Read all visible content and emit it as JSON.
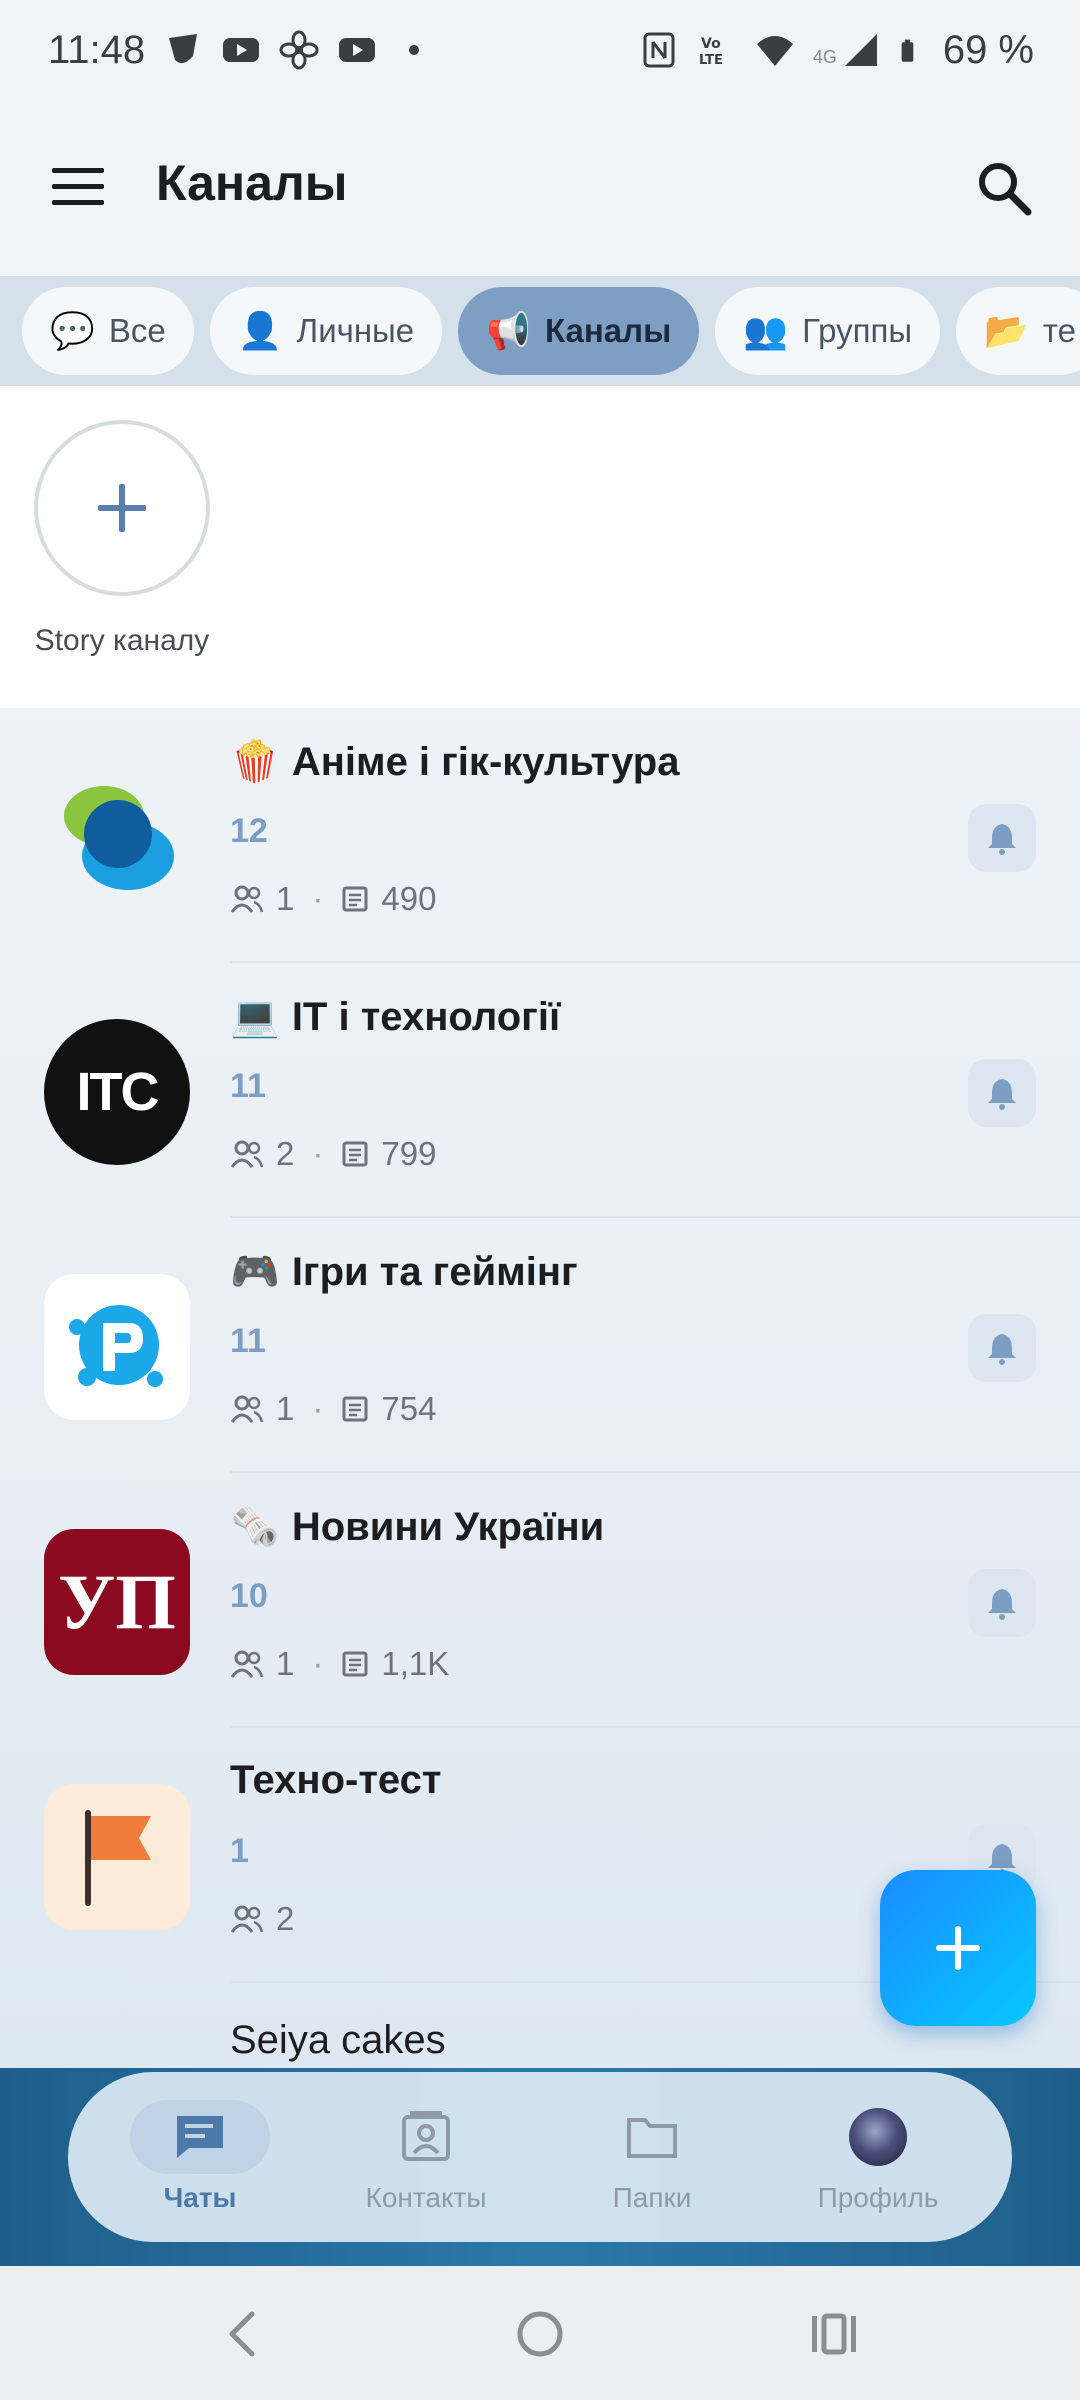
{
  "status_bar": {
    "time": "11:48",
    "battery": "69 %",
    "network": "4G"
  },
  "app_bar": {
    "title": "Каналы"
  },
  "tabs": [
    {
      "emoji": "💬",
      "label": "Все",
      "active": false
    },
    {
      "emoji": "👤",
      "label": "Личные",
      "active": false
    },
    {
      "emoji": "📢",
      "label": "Каналы",
      "active": true
    },
    {
      "emoji": "👥",
      "label": "Группы",
      "active": false
    },
    {
      "emoji": "📂",
      "label": "те",
      "active": false
    }
  ],
  "story": {
    "label": "Story каналу"
  },
  "channels": [
    {
      "emoji": "🍿",
      "title": "Аніме і гік-культура",
      "count": "12",
      "members": "1",
      "posts": "490"
    },
    {
      "emoji": "💻",
      "title": "IT і технології",
      "count": "11",
      "members": "2",
      "posts": "799"
    },
    {
      "emoji": "🎮",
      "title": "Ігри та геймінг",
      "count": "11",
      "members": "1",
      "posts": "754"
    },
    {
      "emoji": "🗞️",
      "title": "Новини України",
      "count": "10",
      "members": "1",
      "posts": "1,1K"
    },
    {
      "emoji": "",
      "title": "Техно-тест",
      "count": "1",
      "members": "2",
      "posts": ""
    }
  ],
  "partial_channel": {
    "title": "Seiya cakes"
  },
  "avatars": {
    "itc": "ITC",
    "up": "УП"
  },
  "bottom_nav": [
    {
      "label": "Чаты",
      "icon": "chat-icon",
      "active": true
    },
    {
      "label": "Контакты",
      "icon": "contacts-icon",
      "active": false
    },
    {
      "label": "Папки",
      "icon": "folder-icon",
      "active": false
    },
    {
      "label": "Профиль",
      "icon": "profile-avatar",
      "active": false
    }
  ],
  "colors": {
    "accent": "#7c9dc4",
    "fab_start": "#1a8cff",
    "fab_end": "#07c7ff",
    "active_tab": "#7e9fc3"
  }
}
